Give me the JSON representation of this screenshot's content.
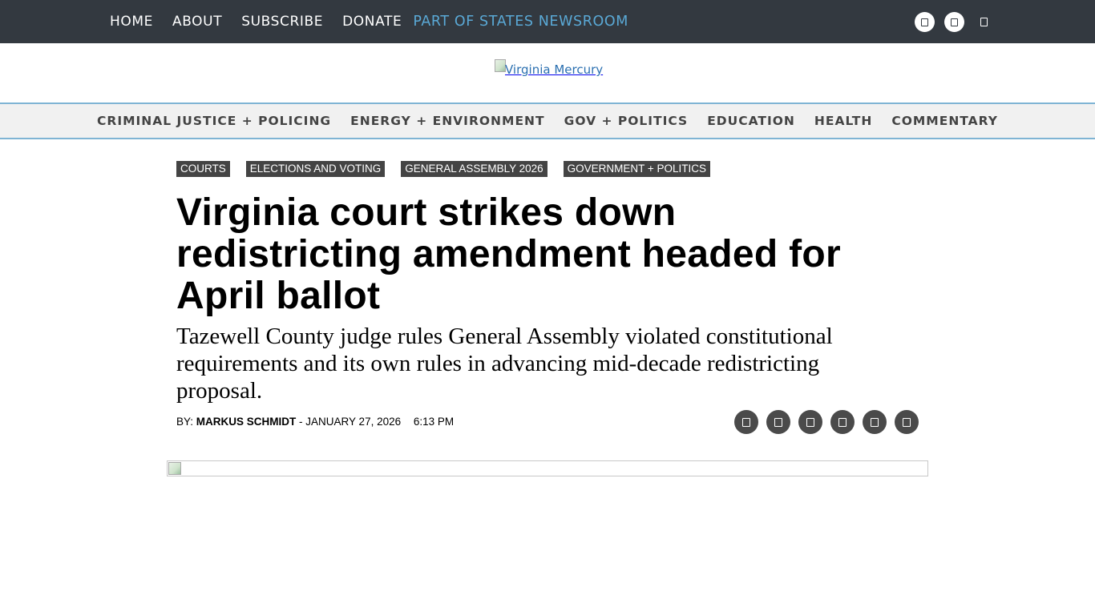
{
  "topbar": {
    "nav": [
      "HOME",
      "ABOUT",
      "SUBSCRIBE",
      "DONATE"
    ],
    "states_link": "PART OF STATES NEWSROOM",
    "icons": [
      "social-icon",
      "social-icon",
      "search-icon"
    ]
  },
  "logo": {
    "alt": "Virginia Mercury"
  },
  "categories": [
    "CRIMINAL JUSTICE + POLICING",
    "ENERGY + ENVIRONMENT",
    "GOV + POLITICS",
    "EDUCATION",
    "HEALTH",
    "COMMENTARY"
  ],
  "article": {
    "tags": [
      "COURTS",
      "ELECTIONS AND VOTING",
      "GENERAL ASSEMBLY 2026",
      "GOVERNMENT + POLITICS"
    ],
    "headline": "Virginia court strikes down redistricting amendment headed for April ballot",
    "subhead": "Tazewell County judge rules General Assembly violated constitutional requirements and its own rules in advancing mid-decade redistricting proposal.",
    "byline": {
      "by_label": "BY:",
      "author": "MARKUS SCHMIDT",
      "separator": " - ",
      "date": "JANUARY 27, 2026",
      "time": "6:13 PM"
    },
    "share_icons": [
      "share-icon",
      "share-icon",
      "share-icon",
      "share-icon",
      "share-icon",
      "share-icon"
    ]
  },
  "colors": {
    "topbar_bg": "#333940",
    "states_link": "#5aa9d6",
    "tag_bg": "#444444",
    "nav_border": "#7fb4d4"
  }
}
